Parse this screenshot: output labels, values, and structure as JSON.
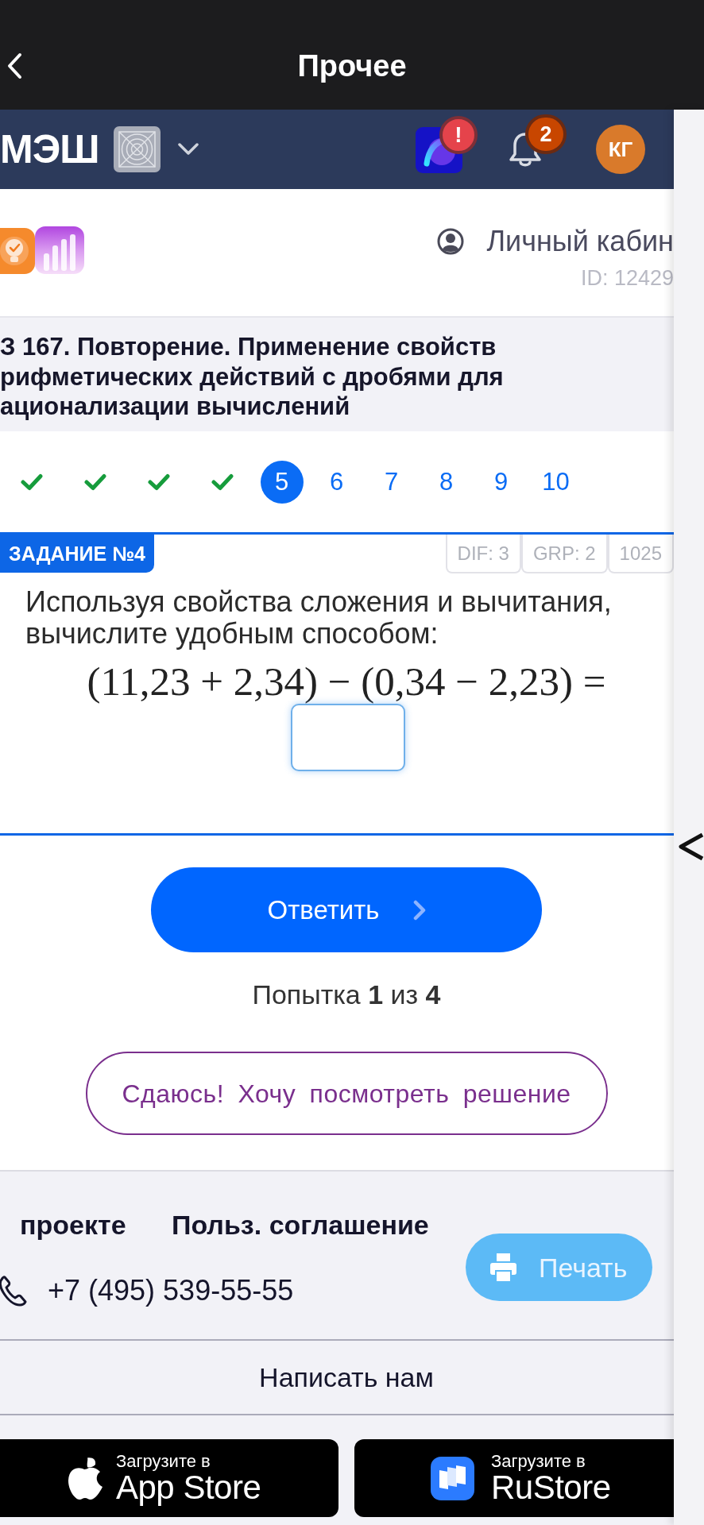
{
  "top_bar": {
    "title": "Прочее"
  },
  "header": {
    "logo": "МЭШ",
    "alert_badge": "!",
    "notification_count": "2",
    "avatar_initials": "КГ"
  },
  "profile": {
    "link": "Личный кабин",
    "user_id": "ID: 12429"
  },
  "lesson_title": "З 167. Повторение. Применение свойств рифметических действий с дробями для ационализации вычислений",
  "steps": [
    {
      "kind": "done",
      "selected": false
    },
    {
      "kind": "done",
      "selected": false
    },
    {
      "kind": "done",
      "selected": false
    },
    {
      "kind": "done",
      "selected": false
    },
    {
      "kind": "number",
      "label": "5",
      "selected": true
    },
    {
      "kind": "number",
      "label": "6",
      "selected": false
    },
    {
      "kind": "number",
      "label": "7",
      "selected": false
    },
    {
      "kind": "number",
      "label": "8",
      "selected": false
    },
    {
      "kind": "number",
      "label": "9",
      "selected": false
    },
    {
      "kind": "number",
      "label": "10",
      "selected": false
    }
  ],
  "task": {
    "badge": "ЗАДАНИЕ №4",
    "tags": [
      "DIF: 3",
      "GRP: 2",
      "1025"
    ],
    "question": "Используя свойства сложения и вычитания, вычислите удобным способом:",
    "formula": "(11,23 + 2,34) − (0,34 − 2,23) ="
  },
  "actions": {
    "submit": "Ответить",
    "attempt": "Попытка **1** из **4**",
    "give_up": "Сдаюсь! Хочу посмотреть решение"
  },
  "footer": {
    "links": [
      "проекте",
      "Польз. соглашение"
    ],
    "phone": "+7 (495) 539-55-55",
    "contact_button": "Написать нам",
    "print_button": "Печать",
    "stores": [
      {
        "kind": "apple",
        "caption": "Загрузите в",
        "name": "App Store"
      },
      {
        "kind": "rustore",
        "caption": "Загрузите в",
        "name": "RuStore"
      }
    ]
  }
}
